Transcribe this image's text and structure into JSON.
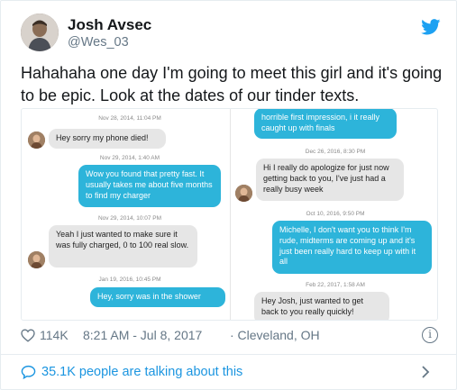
{
  "tweet": {
    "author_name": "Josh Avsec",
    "author_handle": "@Wes_03",
    "text": "Hahahaha one day I'm going to meet this girl and it's going to be epic. Look at the dates of our tinder texts."
  },
  "conversation": {
    "left": [
      {
        "type": "timestamp",
        "text": "Nov 28, 2014, 11:04 PM"
      },
      {
        "type": "in",
        "text": "Hey sorry my phone died!"
      },
      {
        "type": "timestamp",
        "text": "Nov 29, 2014, 1:40 AM"
      },
      {
        "type": "out",
        "text": "Wow you found that pretty fast. It usually takes me about  five months to find my charger"
      },
      {
        "type": "timestamp",
        "text": "Nov 29, 2014, 10:07 PM"
      },
      {
        "type": "in",
        "text": "Yeah I just wanted to make sure it was fully charged, 0 to 100 real slow."
      },
      {
        "type": "timestamp",
        "text": "Jan 19, 2016, 10:45 PM"
      },
      {
        "type": "out",
        "text": "Hey, sorry was in the shower"
      }
    ],
    "right": [
      {
        "type": "out",
        "text": "horrible first impression, i it really caught up with finals"
      },
      {
        "type": "timestamp",
        "text": "Dec 26, 2016, 8:30 PM"
      },
      {
        "type": "in",
        "text": "Hi I really do apologize for just now getting back to you, I've just had a really busy week"
      },
      {
        "type": "timestamp",
        "text": "Oct 10, 2016, 9:50 PM"
      },
      {
        "type": "out",
        "text": "Michelle, I don't want you to think I'm rude, midterms are coming up and it's just been really hard to keep up with it all"
      },
      {
        "type": "timestamp",
        "text": "Feb 22, 2017, 1:58 AM"
      },
      {
        "type": "in",
        "text": "Hey Josh, just wanted to get back to you really quickly!"
      }
    ]
  },
  "meta": {
    "likes": "114K",
    "timestamp": "8:21 AM - Jul 8, 2017",
    "location": "· Cleveland, OH",
    "info_symbol": "i"
  },
  "footer": {
    "talking_text": "35.1K people are talking about this"
  },
  "colors": {
    "brand_blue": "#1da1f2",
    "link_blue": "#1b95e0",
    "sent_bubble": "#2db4da",
    "received_bubble": "#e6e6e6",
    "muted_text": "#657786"
  },
  "icons": [
    "twitter-logo-icon",
    "heart-icon",
    "info-icon",
    "comment-icon",
    "chevron-right-icon"
  ]
}
